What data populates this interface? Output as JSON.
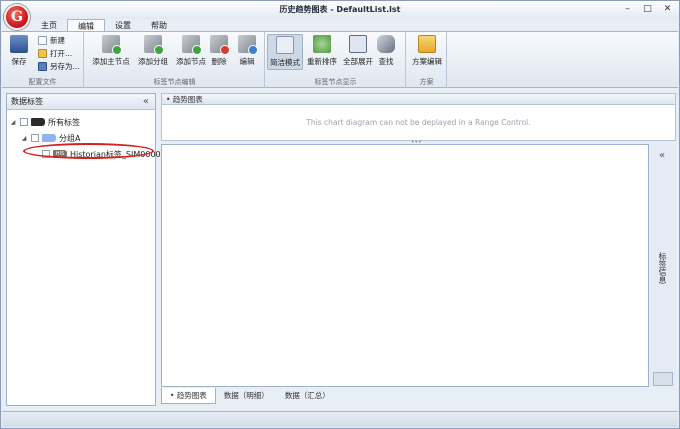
{
  "window": {
    "title": "历史趋势图表 - DefaultList.lst",
    "logo_letter": "G",
    "minimize": "–",
    "maximize": "□",
    "close": "✕"
  },
  "tabs": [
    "主页",
    "编辑",
    "设置",
    "帮助"
  ],
  "ribbon": {
    "config_file": {
      "label": "配置文件",
      "save": "保存",
      "new": "新建",
      "open": "打开...",
      "save_as": "另存为..."
    },
    "node_edit": {
      "label": "标签节点编辑",
      "add_main": "添加主节点",
      "add_group": "添加分组",
      "add_node": "添加节点",
      "delete": "删除",
      "edit": "编辑"
    },
    "node_display": {
      "label": "标签节点显示",
      "simple": "简洁模式",
      "resort": "重新排序",
      "expand_all": "全部展开",
      "find": "查找"
    },
    "scheme": {
      "label": "方案",
      "scheme_edit": "方案编辑"
    }
  },
  "left_panel": {
    "title": "数据标签",
    "collapse": "«",
    "tree": [
      {
        "label": "所有标签",
        "badge": ""
      },
      {
        "label": "分组A",
        "badge": ""
      },
      {
        "label": "Historian标签_SIM00001",
        "badge": "HIS"
      }
    ]
  },
  "trend": {
    "header": "• 趋势图表",
    "message": "This chart diagram can not be deplayed in a Range Control."
  },
  "side_strip": {
    "collapse": "«",
    "label": "标签信息"
  },
  "bottom_tabs": [
    "• 趋势图表",
    "数据（明细）",
    "数据（汇总）"
  ]
}
